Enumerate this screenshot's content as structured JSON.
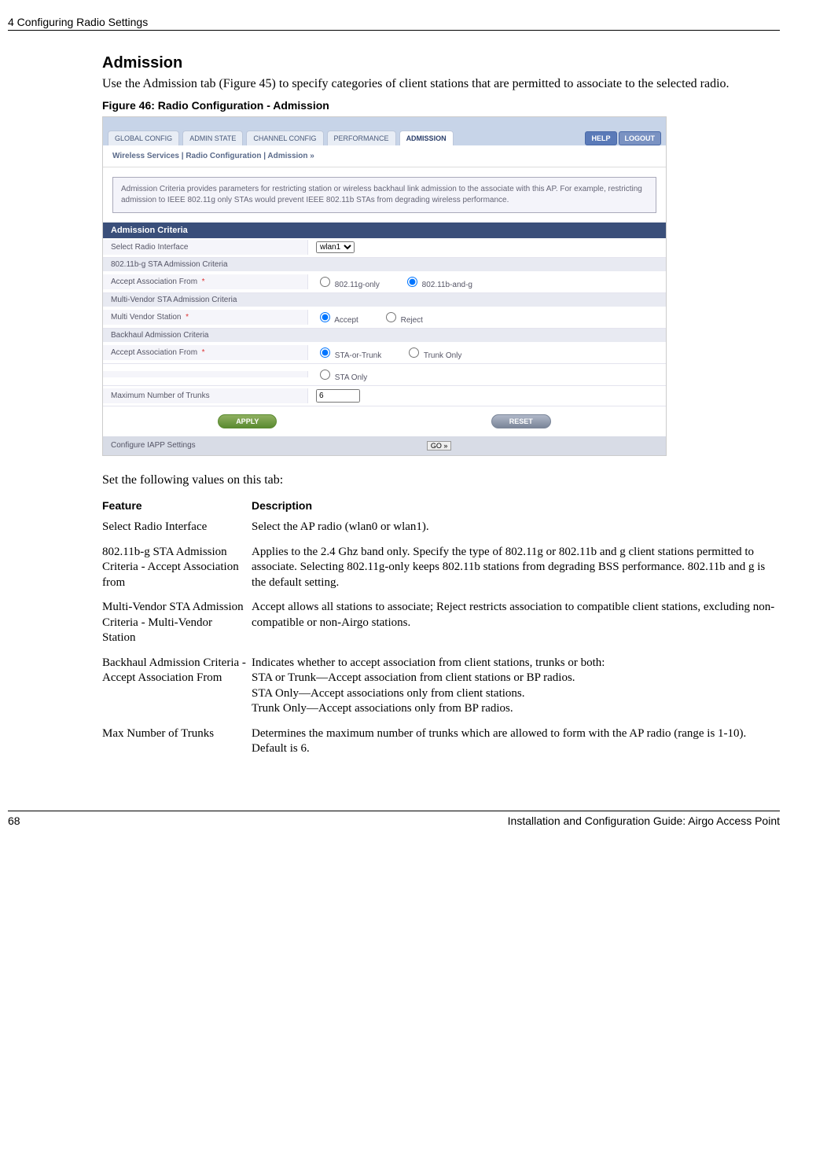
{
  "header": {
    "chapter": "4  Configuring Radio Settings"
  },
  "section": {
    "title": "Admission",
    "intro": "Use the Admission tab (Figure 45) to specify categories of client stations that are permitted to associate to the selected radio.",
    "figure_caption": "Figure 46:      Radio Configuration - Admission",
    "set_values_text": "Set the following values on this tab:"
  },
  "screenshot": {
    "tabs": [
      "GLOBAL CONFIG",
      "ADMIN STATE",
      "CHANNEL CONFIG",
      "PERFORMANCE",
      "ADMISSION"
    ],
    "active_tab_index": 4,
    "help": "HELP",
    "logout": "LOGOUT",
    "breadcrumb": "Wireless Services | Radio Configuration | Admission  »",
    "infobox": "Admission Criteria provides parameters for restricting station or wireless backhaul link admission to the associate with this AP. For example, restricting admission to IEEE 802.11g only STAs would prevent IEEE 802.11b STAs from degrading wireless performance.",
    "section_header": "Admission Criteria",
    "rows": {
      "select_radio": {
        "label": "Select Radio Interface",
        "value": "wlan1"
      },
      "sub1": "802.11b-g STA Admission Criteria",
      "accept_assoc": {
        "label": "Accept Association From",
        "opt1": "802.11g-only",
        "opt2": "802.11b-and-g"
      },
      "sub2": "Multi-Vendor STA Admission Criteria",
      "multi_vendor": {
        "label": "Multi Vendor Station",
        "opt1": "Accept",
        "opt2": "Reject"
      },
      "sub3": "Backhaul Admission Criteria",
      "backhaul": {
        "label": "Accept Association From",
        "opt1": "STA-or-Trunk",
        "opt2": "Trunk Only",
        "opt3": "STA Only"
      },
      "max_trunks": {
        "label": "Maximum Number of Trunks",
        "value": "6"
      }
    },
    "apply": "APPLY",
    "reset": "RESET",
    "iapp": {
      "label": "Configure IAPP Settings",
      "go": "GO »"
    }
  },
  "table": {
    "headers": {
      "feature": "Feature",
      "description": "Description"
    },
    "rows": [
      {
        "feature": "Select Radio Interface",
        "description": "Select the AP radio (wlan0 or wlan1)."
      },
      {
        "feature": "802.11b-g STA Admission Criteria - Accept Association from",
        "description": "Applies to the 2.4 Ghz band only. Specify the type of 802.11g or 802.11b and g client stations permitted to associate. Selecting 802.11g-only keeps 802.11b stations from degrading BSS performance. 802.11b and g is the default setting."
      },
      {
        "feature": "Multi-Vendor STA Admission Criteria - Multi-Vendor Station",
        "description": "Accept allows all stations to associate; Reject restricts association to compatible client stations, excluding non-compatible or non-Airgo stations."
      },
      {
        "feature": "Backhaul Admission Criteria - Accept Association From",
        "description": "Indicates whether to accept association from client stations, trunks or both:\nSTA or Trunk—Accept association from client stations or BP radios.\nSTA Only—Accept associations only from client stations.\nTrunk Only—Accept associations only from BP radios."
      },
      {
        "feature": "Max Number of Trunks",
        "description": "Determines the maximum number of trunks which are allowed to form with the AP radio (range is 1-10). Default is 6."
      }
    ]
  },
  "footer": {
    "page_number": "68",
    "doc_title": "Installation and Configuration Guide: Airgo Access Point"
  }
}
